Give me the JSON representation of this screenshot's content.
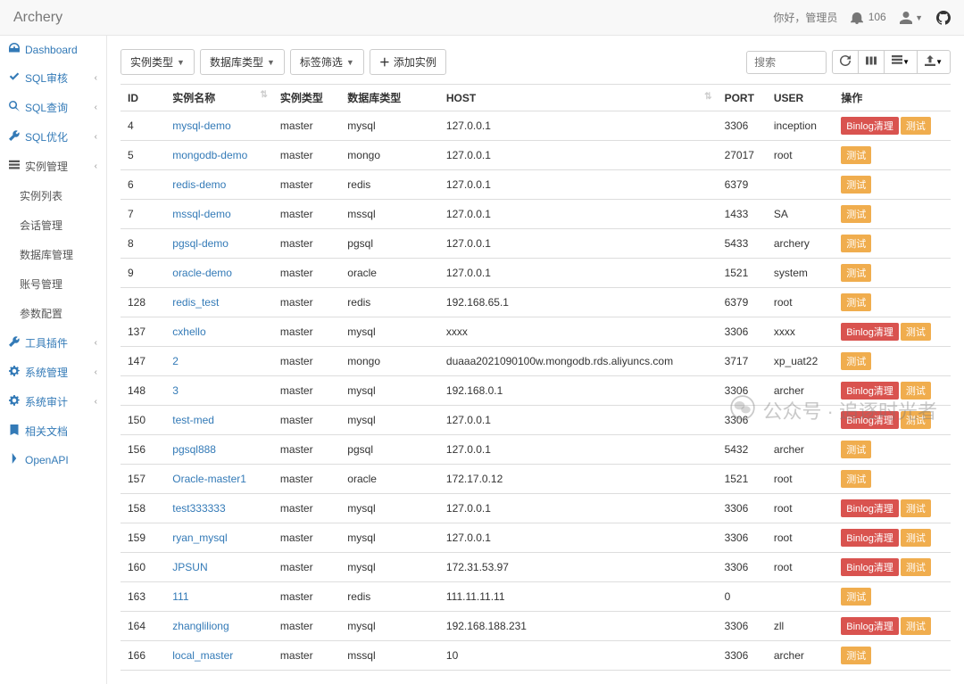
{
  "header": {
    "brand": "Archery",
    "greeting": "你好，管理员",
    "notification_count": "106"
  },
  "sidebar": {
    "items": [
      {
        "label": "Dashboard",
        "icon": "dashboard-icon",
        "expandable": false
      },
      {
        "label": "SQL审核",
        "icon": "check-icon",
        "expandable": true
      },
      {
        "label": "SQL查询",
        "icon": "search-icon",
        "expandable": true
      },
      {
        "label": "SQL优化",
        "icon": "wrench-icon",
        "expandable": true
      },
      {
        "label": "实例管理",
        "icon": "list-icon",
        "expandable": true,
        "active": true
      },
      {
        "label": "实例列表",
        "sub": true,
        "active": true
      },
      {
        "label": "会话管理",
        "sub": true
      },
      {
        "label": "数据库管理",
        "sub": true
      },
      {
        "label": "账号管理",
        "sub": true
      },
      {
        "label": "参数配置",
        "sub": true
      },
      {
        "label": "工具插件",
        "icon": "wrench-icon",
        "expandable": true
      },
      {
        "label": "系统管理",
        "icon": "gear-icon",
        "expandable": true
      },
      {
        "label": "系统审计",
        "icon": "gear-icon",
        "expandable": true
      },
      {
        "label": "相关文档",
        "icon": "book-icon",
        "expandable": false
      },
      {
        "label": "OpenAPI",
        "icon": "chevron-right-icon",
        "expandable": false
      }
    ]
  },
  "toolbar": {
    "instance_type": "实例类型",
    "db_type": "数据库类型",
    "tag_filter": "标签筛选",
    "add_instance": "添加实例",
    "search_placeholder": "搜索"
  },
  "table": {
    "columns": {
      "id": "ID",
      "name": "实例名称",
      "type": "实例类型",
      "db": "数据库类型",
      "host": "HOST",
      "port": "PORT",
      "user": "USER",
      "op": "操作"
    },
    "op_labels": {
      "binlog": "Binlog清理",
      "test": "测试"
    },
    "rows": [
      {
        "id": "4",
        "name": "mysql-demo",
        "type": "master",
        "db": "mysql",
        "host": "127.0.0.1",
        "port": "3306",
        "user": "inception",
        "binlog": true
      },
      {
        "id": "5",
        "name": "mongodb-demo",
        "type": "master",
        "db": "mongo",
        "host": "127.0.0.1",
        "port": "27017",
        "user": "root",
        "binlog": false
      },
      {
        "id": "6",
        "name": "redis-demo",
        "type": "master",
        "db": "redis",
        "host": "127.0.0.1",
        "port": "6379",
        "user": "",
        "binlog": false
      },
      {
        "id": "7",
        "name": "mssql-demo",
        "type": "master",
        "db": "mssql",
        "host": "127.0.0.1",
        "port": "1433",
        "user": "SA",
        "binlog": false
      },
      {
        "id": "8",
        "name": "pgsql-demo",
        "type": "master",
        "db": "pgsql",
        "host": "127.0.0.1",
        "port": "5433",
        "user": "archery",
        "binlog": false
      },
      {
        "id": "9",
        "name": "oracle-demo",
        "type": "master",
        "db": "oracle",
        "host": "127.0.0.1",
        "port": "1521",
        "user": "system",
        "binlog": false
      },
      {
        "id": "128",
        "name": "redis_test",
        "type": "master",
        "db": "redis",
        "host": "192.168.65.1",
        "port": "6379",
        "user": "root",
        "binlog": false
      },
      {
        "id": "137",
        "name": "cxhello",
        "type": "master",
        "db": "mysql",
        "host": "xxxx",
        "port": "3306",
        "user": "xxxx",
        "binlog": true
      },
      {
        "id": "147",
        "name": "2",
        "type": "master",
        "db": "mongo",
        "host": "duaaa2021090100w.mongodb.rds.aliyuncs.com",
        "port": "3717",
        "user": "xp_uat22",
        "binlog": false
      },
      {
        "id": "148",
        "name": "3",
        "type": "master",
        "db": "mysql",
        "host": "192.168.0.1",
        "port": "3306",
        "user": "archer",
        "binlog": true
      },
      {
        "id": "150",
        "name": "test-med",
        "type": "master",
        "db": "mysql",
        "host": "127.0.0.1",
        "port": "3306",
        "user": "",
        "binlog": true
      },
      {
        "id": "156",
        "name": "pgsql888",
        "type": "master",
        "db": "pgsql",
        "host": "127.0.0.1",
        "port": "5432",
        "user": "archer",
        "binlog": false
      },
      {
        "id": "157",
        "name": "Oracle-master1",
        "type": "master",
        "db": "oracle",
        "host": "172.17.0.12",
        "port": "1521",
        "user": "root",
        "binlog": false
      },
      {
        "id": "158",
        "name": "test333333",
        "type": "master",
        "db": "mysql",
        "host": "127.0.0.1",
        "port": "3306",
        "user": "root",
        "binlog": true
      },
      {
        "id": "159",
        "name": "ryan_mysql",
        "type": "master",
        "db": "mysql",
        "host": "127.0.0.1",
        "port": "3306",
        "user": "root",
        "binlog": true
      },
      {
        "id": "160",
        "name": "JPSUN",
        "type": "master",
        "db": "mysql",
        "host": "172.31.53.97",
        "port": "3306",
        "user": "root",
        "binlog": true
      },
      {
        "id": "163",
        "name": "111",
        "type": "master",
        "db": "redis",
        "host": "111.11.11.11",
        "port": "0",
        "user": "",
        "binlog": false
      },
      {
        "id": "164",
        "name": "zhangliliong",
        "type": "master",
        "db": "mysql",
        "host": "192.168.188.231",
        "port": "3306",
        "user": "zll",
        "binlog": true
      },
      {
        "id": "166",
        "name": "local_master",
        "type": "master",
        "db": "mssql",
        "host": "10",
        "port": "3306",
        "user": "archer",
        "binlog": false
      }
    ]
  },
  "watermark": "公众号 · 追逐时光者"
}
